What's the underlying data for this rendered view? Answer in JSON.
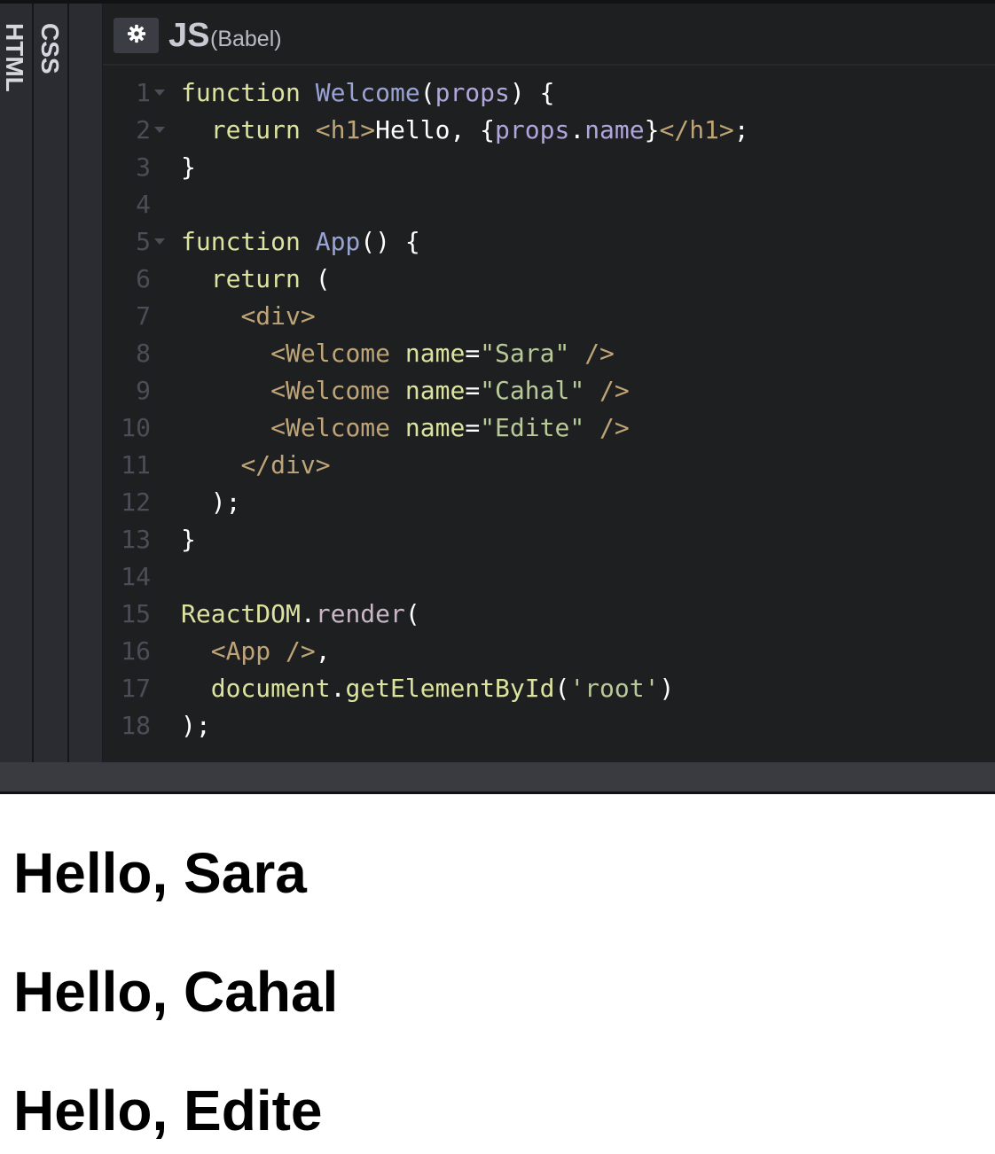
{
  "panels": {
    "html_tab": "HTML",
    "css_tab": "CSS",
    "js_title": "JS",
    "js_subtitle": "(Babel)"
  },
  "icons": {
    "settings": "gear-icon",
    "fold": "fold-arrow-icon"
  },
  "colors": {
    "editor_bg": "#1d1f20",
    "keyword": "#dde39e",
    "function_name": "#9aa3d6",
    "jsx_tag": "#bea477",
    "string": "#b8c99a",
    "line_number": "#4b4e56"
  },
  "code_lines": [
    {
      "num": "1",
      "fold": true,
      "tokens": [
        [
          "kw",
          "function"
        ],
        [
          "pl",
          " "
        ],
        [
          "fn",
          "Welcome"
        ],
        [
          "pl",
          "("
        ],
        [
          "param",
          "props"
        ],
        [
          "pl",
          ") {"
        ]
      ]
    },
    {
      "num": "2",
      "fold": true,
      "tokens": [
        [
          "pl",
          "  "
        ],
        [
          "kw",
          "return"
        ],
        [
          "pl",
          " "
        ],
        [
          "tag",
          "<h1>"
        ],
        [
          "pl",
          "Hello, {"
        ],
        [
          "param",
          "props"
        ],
        [
          "pl",
          "."
        ],
        [
          "prop",
          "name"
        ],
        [
          "pl",
          "}"
        ],
        [
          "tag",
          "</h1>"
        ],
        [
          "pl",
          ";"
        ]
      ]
    },
    {
      "num": "3",
      "fold": false,
      "tokens": [
        [
          "pl",
          "}"
        ]
      ]
    },
    {
      "num": "4",
      "fold": false,
      "tokens": []
    },
    {
      "num": "5",
      "fold": true,
      "tokens": [
        [
          "kw",
          "function"
        ],
        [
          "pl",
          " "
        ],
        [
          "fn",
          "App"
        ],
        [
          "pl",
          "() {"
        ]
      ]
    },
    {
      "num": "6",
      "fold": false,
      "tokens": [
        [
          "pl",
          "  "
        ],
        [
          "kw",
          "return"
        ],
        [
          "pl",
          " ("
        ]
      ]
    },
    {
      "num": "7",
      "fold": false,
      "tokens": [
        [
          "pl",
          "    "
        ],
        [
          "tag",
          "<div>"
        ]
      ]
    },
    {
      "num": "8",
      "fold": false,
      "tokens": [
        [
          "pl",
          "      "
        ],
        [
          "tag",
          "<Welcome"
        ],
        [
          "pl",
          " "
        ],
        [
          "attr",
          "name"
        ],
        [
          "pl",
          "="
        ],
        [
          "str",
          "\"Sara\""
        ],
        [
          "pl",
          " "
        ],
        [
          "tag",
          "/>"
        ]
      ]
    },
    {
      "num": "9",
      "fold": false,
      "tokens": [
        [
          "pl",
          "      "
        ],
        [
          "tag",
          "<Welcome"
        ],
        [
          "pl",
          " "
        ],
        [
          "attr",
          "name"
        ],
        [
          "pl",
          "="
        ],
        [
          "str",
          "\"Cahal\""
        ],
        [
          "pl",
          " "
        ],
        [
          "tag",
          "/>"
        ]
      ]
    },
    {
      "num": "10",
      "fold": false,
      "tokens": [
        [
          "pl",
          "      "
        ],
        [
          "tag",
          "<Welcome"
        ],
        [
          "pl",
          " "
        ],
        [
          "attr",
          "name"
        ],
        [
          "pl",
          "="
        ],
        [
          "str",
          "\"Edite\""
        ],
        [
          "pl",
          " "
        ],
        [
          "tag",
          "/>"
        ]
      ]
    },
    {
      "num": "11",
      "fold": false,
      "tokens": [
        [
          "pl",
          "    "
        ],
        [
          "tag",
          "</div>"
        ]
      ]
    },
    {
      "num": "12",
      "fold": false,
      "tokens": [
        [
          "pl",
          "  );"
        ]
      ]
    },
    {
      "num": "13",
      "fold": false,
      "tokens": [
        [
          "pl",
          "}"
        ]
      ]
    },
    {
      "num": "14",
      "fold": false,
      "tokens": []
    },
    {
      "num": "15",
      "fold": false,
      "tokens": [
        [
          "kw",
          "ReactDOM"
        ],
        [
          "pl",
          "."
        ],
        [
          "mth",
          "render"
        ],
        [
          "pl",
          "("
        ]
      ]
    },
    {
      "num": "16",
      "fold": false,
      "tokens": [
        [
          "pl",
          "  "
        ],
        [
          "tag",
          "<App />"
        ],
        [
          "pl",
          ","
        ]
      ]
    },
    {
      "num": "17",
      "fold": false,
      "tokens": [
        [
          "pl",
          "  "
        ],
        [
          "kw",
          "document"
        ],
        [
          "pl",
          "."
        ],
        [
          "kw",
          "getElementById"
        ],
        [
          "pl",
          "("
        ],
        [
          "str",
          "'root'"
        ],
        [
          "pl",
          ")"
        ]
      ]
    },
    {
      "num": "18",
      "fold": false,
      "tokens": [
        [
          "pl",
          ");"
        ]
      ]
    }
  ],
  "result": {
    "greetings": [
      "Hello, Sara",
      "Hello, Cahal",
      "Hello, Edite"
    ]
  }
}
